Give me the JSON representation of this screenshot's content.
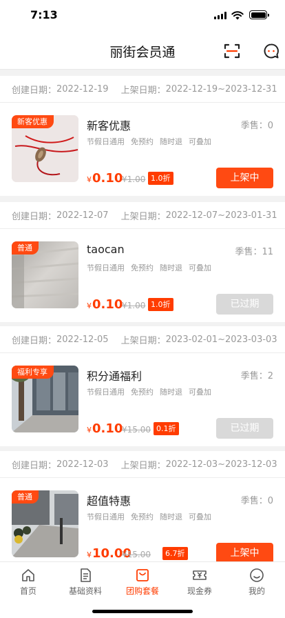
{
  "status_bar": {
    "time": "7:13"
  },
  "nav": {
    "title": "丽街会员通",
    "scan_icon": "scan-icon",
    "chat_icon": "chat-icon"
  },
  "labels": {
    "created": "创建日期：",
    "listed": "上架日期：",
    "season": "季售：",
    "currency": "¥"
  },
  "items": [
    {
      "created_date": "2022-12-19",
      "listed_range": "2022-12-19~2023-12-31",
      "tag": "新客优惠",
      "name": "新客优惠",
      "season_count": "0",
      "features": [
        "节假日通用",
        "免预约",
        "随时退",
        "可叠加"
      ],
      "price": "0.10",
      "orig_price": "¥1.00",
      "discount": "1.0折",
      "status": "上架中",
      "status_type": "active"
    },
    {
      "created_date": "2022-12-07",
      "listed_range": "2022-12-07~2023-01-31",
      "tag": "普通",
      "name": "taocan",
      "season_count": "11",
      "features": [
        "节假日通用",
        "免预约",
        "随时退",
        "可叠加"
      ],
      "price": "0.10",
      "orig_price": "¥1.00",
      "discount": "1.0折",
      "status": "已过期",
      "status_type": "expired"
    },
    {
      "created_date": "2022-12-05",
      "listed_range": "2023-02-01~2023-03-03",
      "tag": "福利专享",
      "name": "积分通福利",
      "season_count": "2",
      "features": [
        "节假日通用",
        "免预约",
        "随时退",
        "可叠加"
      ],
      "price": "0.10",
      "orig_price": "¥15.00",
      "discount": "0.1折",
      "status": "已过期",
      "status_type": "expired"
    },
    {
      "created_date": "2022-12-03",
      "listed_range": "2022-12-03~2023-12-03",
      "tag": "普通",
      "name": "超值特惠",
      "season_count": "0",
      "features": [
        "节假日通用",
        "免预约",
        "随时退",
        "可叠加"
      ],
      "price": "10.00",
      "orig_price": "¥15.00",
      "discount": "6.7折",
      "status": "上架中",
      "status_type": "active"
    }
  ],
  "tabs": [
    {
      "label": "首页",
      "icon": "home-icon"
    },
    {
      "label": "基础资料",
      "icon": "document-icon"
    },
    {
      "label": "团购套餐",
      "icon": "shopping-bag-icon",
      "active": true
    },
    {
      "label": "现金券",
      "icon": "coupon-icon"
    },
    {
      "label": "我的",
      "icon": "profile-icon"
    }
  ],
  "colors": {
    "accent": "#ff4a12",
    "price": "#ff3c00",
    "expired": "#d9d9d9"
  }
}
